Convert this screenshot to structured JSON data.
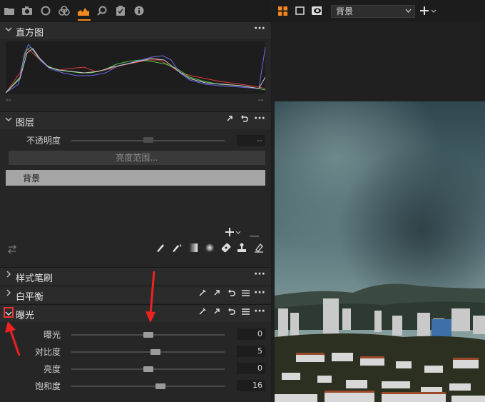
{
  "toolbar": {
    "icons": [
      "folder-icon",
      "camera-icon",
      "circle-icon",
      "color-balance-icon",
      "exposure-icon",
      "search-icon",
      "clipboard-icon",
      "info-icon"
    ],
    "active_icon": "exposure-icon",
    "accent": "#f5871f"
  },
  "histogram": {
    "title": "直方图",
    "min_label": "--",
    "max_label": "--"
  },
  "layers": {
    "title": "图层",
    "opacity_label": "不透明度",
    "opacity_value": "--",
    "range_button": "亮度范围...",
    "items": [
      {
        "label": "背景",
        "selected": true
      }
    ]
  },
  "style_brush": {
    "title": "样式笔刷"
  },
  "white_balance": {
    "title": "白平衡"
  },
  "exposure": {
    "title": "曝光",
    "sliders": [
      {
        "label": "曝光",
        "value": "0",
        "fraction": 0.5
      },
      {
        "label": "对比度",
        "value": "5",
        "fraction": 0.55
      },
      {
        "label": "亮度",
        "value": "0",
        "fraction": 0.5
      },
      {
        "label": "饱和度",
        "value": "16",
        "fraction": 0.58
      }
    ]
  },
  "viewer": {
    "layer_select": "背景"
  }
}
